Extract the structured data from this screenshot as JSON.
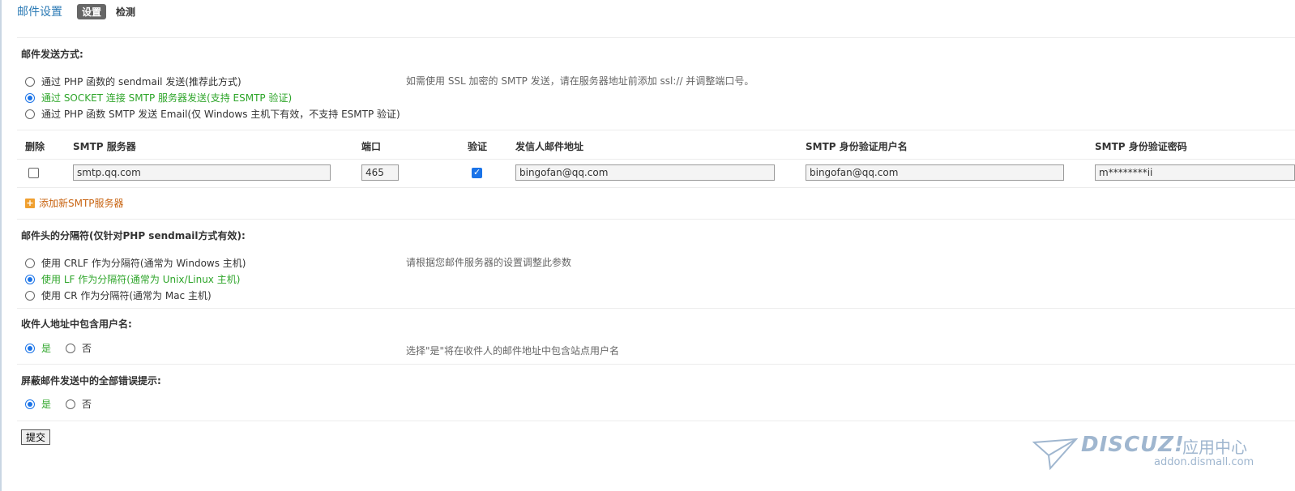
{
  "header": {
    "title": "邮件设置",
    "tabs": [
      "设置",
      "检测"
    ]
  },
  "send_method": {
    "title": "邮件发送方式:",
    "options": [
      "通过 PHP 函数的 sendmail 发送(推荐此方式)",
      "通过 SOCKET 连接 SMTP 服务器发送(支持 ESMTP 验证)",
      "通过 PHP 函数 SMTP 发送 Email(仅 Windows 主机下有效，不支持 ESMTP 验证)"
    ],
    "selected": 1,
    "tip": "如需使用 SSL 加密的 SMTP 发送，请在服务器地址前添加 ssl:// 并调整端口号。"
  },
  "smtp_table": {
    "headers": [
      "删除",
      "SMTP 服务器",
      "端口",
      "验证",
      "发信人邮件地址",
      "SMTP 身份验证用户名",
      "SMTP 身份验证密码"
    ],
    "row": {
      "server": "smtp.qq.com",
      "port": "465",
      "from": "bingofan@qq.com",
      "username": "bingofan@qq.com",
      "password": "m********ii"
    },
    "add_label": "添加新SMTP服务器"
  },
  "separator": {
    "title": "邮件头的分隔符(仅针对PHP sendmail方式有效):",
    "options": [
      "使用 CRLF 作为分隔符(通常为 Windows 主机)",
      "使用 LF 作为分隔符(通常为 Unix/Linux 主机)",
      "使用 CR 作为分隔符(通常为 Mac 主机)"
    ],
    "selected": 1,
    "tip": "请根据您邮件服务器的设置调整此参数"
  },
  "include_username": {
    "title": "收件人地址中包含用户名:",
    "yes": "是",
    "no": "否",
    "tip": "选择\"是\"将在收件人的邮件地址中包含站点用户名"
  },
  "silent": {
    "title": "屏蔽邮件发送中的全部错误提示:",
    "yes": "是",
    "no": "否"
  },
  "submit_label": "提交",
  "watermark": {
    "logo": "DISCUZ!",
    "cn": "应用中心",
    "url": "addon.dismall.com"
  },
  "colors": {
    "accent": "#2b7ab5",
    "selected_text": "#2ea52a",
    "add_link": "#c86412"
  }
}
